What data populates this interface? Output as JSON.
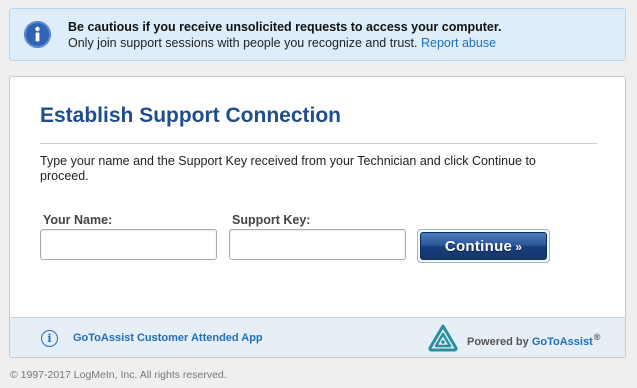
{
  "alert": {
    "title": "Be cautious if you receive unsolicited requests to access your computer.",
    "message": "Only join support sessions with people you recognize and trust.",
    "link": "Report abuse",
    "icon": "info-icon",
    "color": "#2f63b4"
  },
  "card": {
    "title": "Establish Support Connection",
    "instructions": "Type your name and the Support Key received from your Technician and click Continue to proceed.",
    "name_label": "Your Name:",
    "name_value": "",
    "key_label": "Support Key:",
    "key_value": "",
    "continue_label": "Continue",
    "continue_arrow": "»",
    "accent_color": "#1e4e8c"
  },
  "footer": {
    "app_name": "GoToAssist Customer Attended App",
    "powered_prefix": "Powered by",
    "brand": "GoToAssist",
    "registered": "®",
    "logo_icon": "gotoassist-logo-icon",
    "info_icon": "info-circle-icon"
  },
  "copyright": "© 1997-2017 LogMeIn, Inc. All rights reserved."
}
